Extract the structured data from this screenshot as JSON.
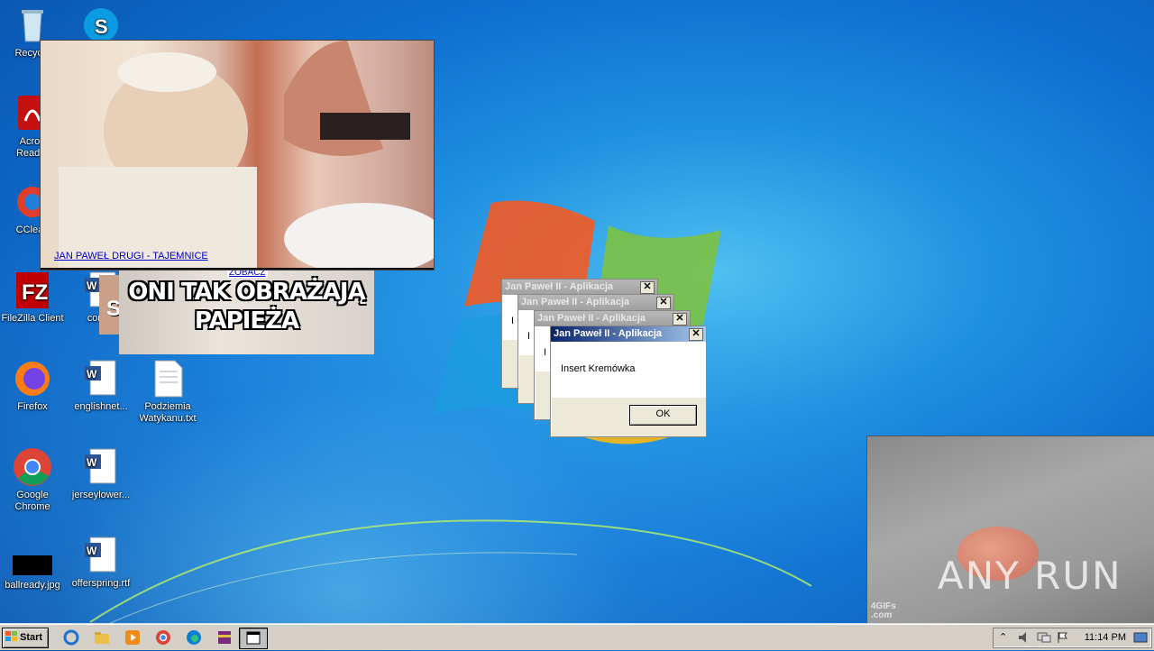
{
  "desktop": {
    "icons": [
      {
        "label": "Recycle",
        "icon": "recycle-bin-icon"
      },
      {
        "label": "Acrob",
        "label2": "Reader",
        "icon": "acrobat-reader-icon"
      },
      {
        "label": "CClean",
        "icon": "ccleaner-icon"
      },
      {
        "label": "FileZilla Client",
        "icon": "filezilla-icon"
      },
      {
        "label": "Firefox",
        "icon": "firefox-icon"
      },
      {
        "label": "Google",
        "label2": "Chrome",
        "icon": "chrome-icon"
      },
      {
        "label": "ballready.jpg",
        "icon": "image-file-icon"
      },
      {
        "label": "",
        "icon": "skype-icon"
      },
      {
        "label": "confer",
        "icon": "word-doc-icon"
      },
      {
        "label": "englishnet...",
        "icon": "word-doc-icon"
      },
      {
        "label": "Podziemia",
        "label2": "Watykanu.txt",
        "icon": "text-file-icon"
      },
      {
        "label": "jerseylower...",
        "icon": "word-doc-icon"
      },
      {
        "label": "offerspring.rtf",
        "icon": "word-doc-icon"
      }
    ]
  },
  "popups": {
    "big_link": "JAN PAWEŁ DRUGI - TAJEMNICE",
    "mid_caption_line1": "ONI TAK OBRAŻAJĄ",
    "mid_caption_line2": "PAPIEŻA",
    "mid_link": "ZOBACZ",
    "small_letter": "S"
  },
  "dialogs": {
    "title": "Jan Paweł II - Aplikacja",
    "close_glyph": "✕",
    "message": "Insert Kremówka",
    "ok_label": "OK",
    "stub_letter": "I"
  },
  "gif_window": {
    "watermark_line1": "4GIFs",
    "watermark_line2": ".com"
  },
  "watermark": "ANY RUN",
  "taskbar": {
    "start_label": "Start",
    "clock": "11:14 PM"
  },
  "colors": {
    "desktop_blue": "#1f8fe0",
    "title_active": "#0a246a",
    "link_blue": "#0000cc"
  }
}
